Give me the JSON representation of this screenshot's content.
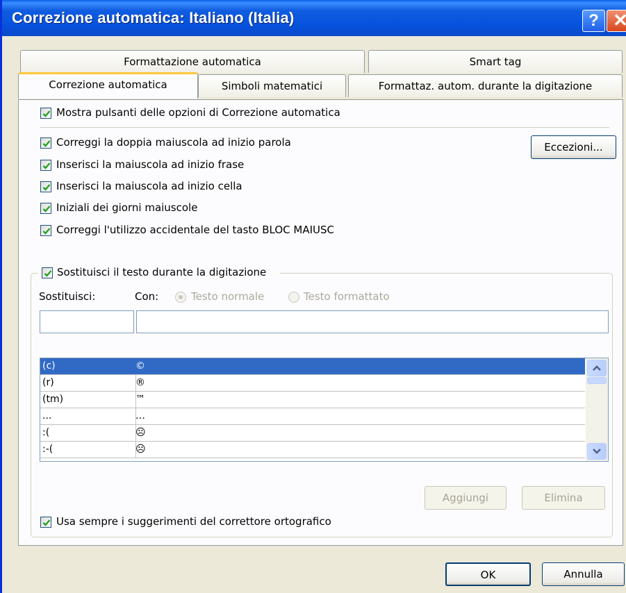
{
  "window": {
    "title": "Correzione automatica: Italiano (Italia)",
    "help_glyph": "?",
    "close_glyph": "✕"
  },
  "tabs": {
    "row1": [
      "Formattazione automatica",
      "Smart tag"
    ],
    "row2": [
      "Correzione automatica",
      "Simboli matematici",
      "Formattaz. autom. durante la digitazione"
    ],
    "active": "Correzione automatica"
  },
  "options": {
    "show_buttons": {
      "label": "Mostra pulsanti delle opzioni di Correzione automatica",
      "checked": true
    },
    "items": [
      {
        "label": "Correggi la doppia maiuscola ad inizio parola",
        "checked": true
      },
      {
        "label": "Inserisci la maiuscola ad inizio frase",
        "checked": true
      },
      {
        "label": "Inserisci la maiuscola ad inizio cella",
        "checked": true
      },
      {
        "label": "Iniziali dei giorni maiuscole",
        "checked": true
      },
      {
        "label": "Correggi l'utilizzo accidentale del tasto BLOC MAIUSC",
        "checked": true
      }
    ],
    "exceptions_button": "Eccezioni..."
  },
  "replace": {
    "group_label": "Sostituisci il testo durante la digitazione",
    "checked": true,
    "replace_label": "Sostituisci:",
    "with_label": "Con:",
    "radio_normal": "Testo normale",
    "radio_formatted": "Testo formattato",
    "replace_value": "",
    "with_value": "",
    "rows": [
      {
        "from": "(c)",
        "to": "©"
      },
      {
        "from": "(r)",
        "to": "®"
      },
      {
        "from": "(tm)",
        "to": "™"
      },
      {
        "from": "...",
        "to": "…"
      },
      {
        "from": ":(",
        "to": "☹"
      },
      {
        "from": ":-(",
        "to": "☹"
      }
    ],
    "add_button": "Aggiungi",
    "delete_button": "Elimina"
  },
  "spell": {
    "label": "Usa sempre i suggerimenti del correttore ortografico",
    "checked": true
  },
  "footer": {
    "ok": "OK",
    "cancel": "Annulla"
  }
}
